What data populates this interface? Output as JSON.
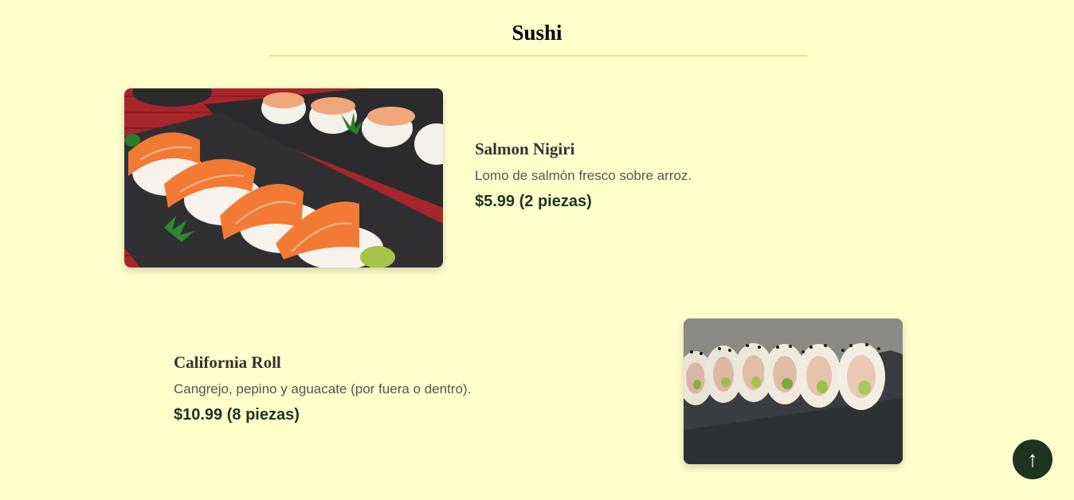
{
  "section": {
    "title": "Sushi"
  },
  "items": [
    {
      "name": "Salmon Nigiri",
      "description": "Lomo de salmón fresco sobre arroz.",
      "price": "$5.99 (2 piezas)"
    },
    {
      "name": "California Roll",
      "description": "Cangrejo, pepino y aguacate (por fuera o dentro).",
      "price": "$10.99 (8 piezas)"
    }
  ],
  "back_to_top": {
    "label": "↑",
    "icon": "arrow-up-icon"
  },
  "colors": {
    "background": "#ffffcc",
    "rule": "#f3d98c",
    "price": "#1f3320",
    "button": "#1e3320"
  }
}
